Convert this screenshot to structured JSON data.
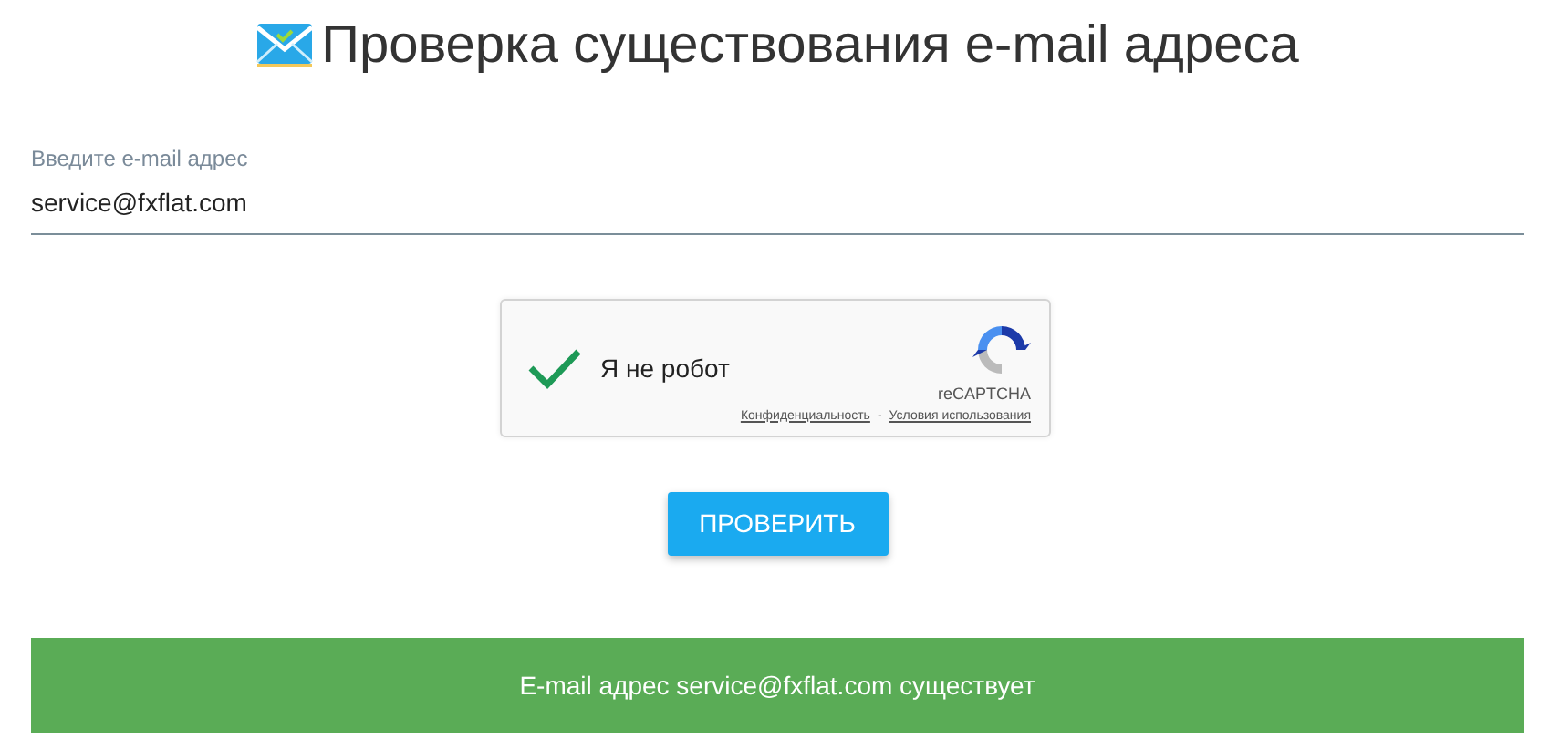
{
  "title": "Проверка существования e-mail адреса",
  "email_field": {
    "label": "Введите e-mail адрес",
    "value": "service@fxflat.com"
  },
  "captcha": {
    "label": "Я не робот",
    "checked": true,
    "brand": "reCAPTCHA",
    "links": [
      "Конфиденциальность",
      "Условия использования"
    ],
    "separator": "-"
  },
  "submit_button": "ПРОВЕРИТЬ",
  "result": {
    "text": "E-mail адрес service@fxflat.com существует",
    "kind": "success"
  }
}
